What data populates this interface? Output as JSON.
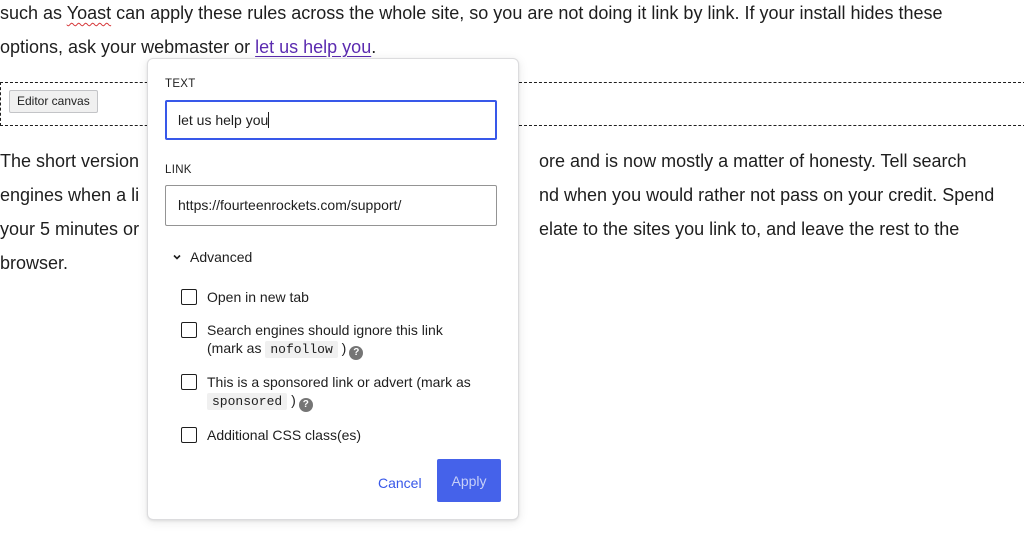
{
  "content": {
    "intro_lines": [
      {
        "before": "such as ",
        "spell": "Yoast",
        "after": " can apply these rules across the whole site, so you are not doing it link by link. If your install hides these"
      },
      {
        "before": "options, ask your webmaster or ",
        "link": "let us help you",
        "after": "."
      }
    ],
    "body_lines": [
      {
        "left": "The short version",
        "right": "ore and is now mostly a matter of honesty. Tell search"
      },
      {
        "left": "engines when a li",
        "right": "nd when you would rather not pass on your credit. Spend"
      },
      {
        "left": "your 5 minutes or",
        "right": "elate to the sites you link to, and leave the rest to the"
      },
      {
        "left": "browser.",
        "right": ""
      }
    ]
  },
  "canvas": {
    "label": "Editor canvas"
  },
  "popover": {
    "text_label": "TEXT",
    "text_value": "let us help you",
    "link_label": "LINK",
    "link_value": "https://fourteenrockets.com/support/",
    "advanced_label": "Advanced",
    "options": [
      {
        "label": "Open in new tab"
      },
      {
        "label_line1": "Search engines should ignore this link",
        "label_pre": "(mark as ",
        "code": "nofollow",
        "label_post": " )"
      },
      {
        "label_line1": "This is a sponsored link or advert (mark as",
        "code": "sponsored",
        "label_post": " )"
      },
      {
        "label": "Additional CSS class(es)"
      }
    ],
    "cancel_label": "Cancel",
    "apply_label": "Apply",
    "help_glyph": "?"
  },
  "colors": {
    "accent": "#3858e9",
    "link_visited": "#5b2bb0"
  }
}
